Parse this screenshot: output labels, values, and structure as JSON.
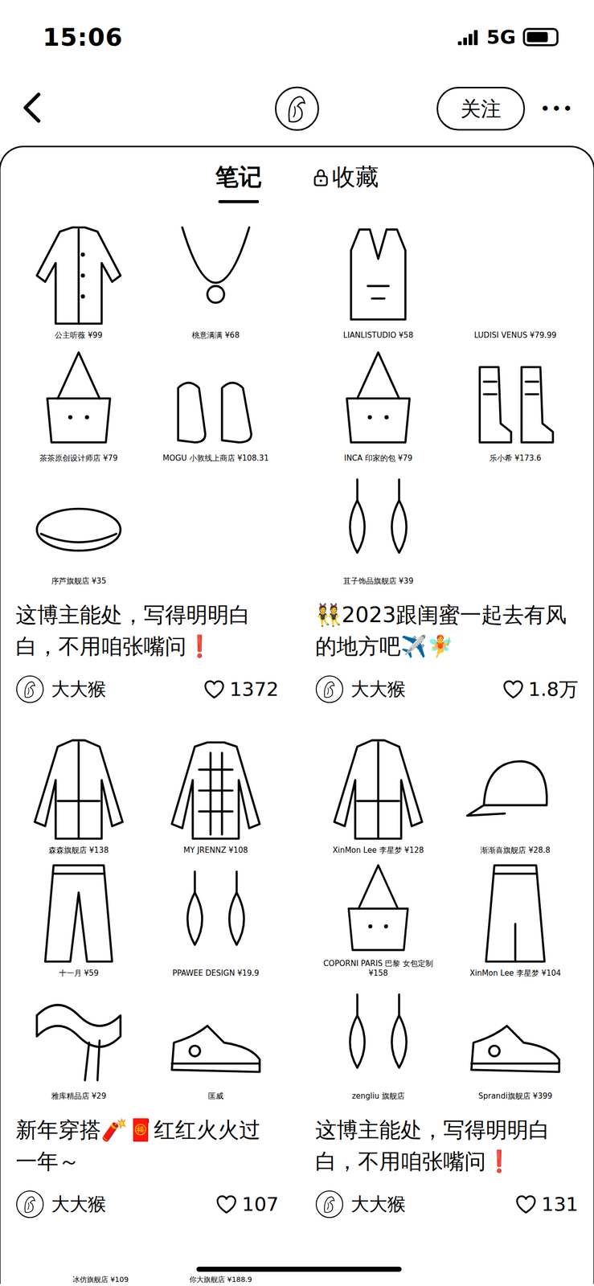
{
  "status_bar": {
    "time": "15:06",
    "network": "5G",
    "signal": 1,
    "battery": 0.75
  },
  "header": {
    "follow_button": "关注",
    "more": "•••"
  },
  "tabs": [
    {
      "label": "笔记",
      "selected": true,
      "locked": false
    },
    {
      "label": "收藏",
      "selected": false,
      "locked": true
    }
  ],
  "notes": [
    {
      "title": "这博主能处，写得明明白白，不用咱张嘴问❗",
      "author": "大大猴",
      "likes": "1372",
      "liked": false,
      "items": [
        {
          "label": "公主听薇 ¥99",
          "kind": "cardigan"
        },
        {
          "label": "桃意满满 ¥68",
          "kind": "necklace"
        },
        {
          "label": "茶茶原创设计师店 ¥79",
          "kind": "bag"
        },
        {
          "label": "MOGU 小敦线上商店 ¥108.31",
          "kind": "shoes"
        },
        {
          "label": "序芦旗舰店 ¥35",
          "kind": "beret"
        }
      ]
    },
    {
      "title": "👯2023跟闺蜜一起去有风的地方吧✈️🧚",
      "author": "大大猴",
      "likes": "1.8万",
      "liked": false,
      "items": [
        {
          "label": "LIANLISTUDIO ¥58",
          "kind": "vest"
        },
        {
          "label": "LUDISI VENUS ¥79.99",
          "kind": "label"
        },
        {
          "label": "INCA 印家的包 ¥79",
          "kind": "bag"
        },
        {
          "label": "乐小希 ¥173.6",
          "kind": "boots"
        },
        {
          "label": "苴子饰品旗舰店 ¥39",
          "kind": "earrings"
        }
      ]
    },
    {
      "title": "新年穿搭🧨🧧红红火火过一年～",
      "author": "大大猴",
      "likes": "107",
      "liked": false,
      "items": [
        {
          "label": "森森旗舰店 ¥138",
          "kind": "jacket"
        },
        {
          "label": "MY JRENNZ ¥108",
          "kind": "sweater"
        },
        {
          "label": "十一月 ¥59",
          "kind": "pants"
        },
        {
          "label": "PPAWEE DESIGN ¥19.9",
          "kind": "earrings"
        },
        {
          "label": "雅库精品店 ¥29",
          "kind": "scarf"
        },
        {
          "label": "匡威",
          "kind": "sneakers"
        }
      ]
    },
    {
      "title": "这博主能处，写得明明白白，不用咱张嘴问❗",
      "author": "大大猴",
      "likes": "131",
      "liked": false,
      "items": [
        {
          "label": "XinMon Lee 李星梦 ¥128",
          "kind": "jacket"
        },
        {
          "label": "渐渐喜旗舰店 ¥28.8",
          "kind": "cap"
        },
        {
          "label": "COPORNI PARIS 巴黎 女包定制 ¥158",
          "kind": "bag"
        },
        {
          "label": "XinMon Lee 李星梦 ¥104",
          "kind": "skirt"
        },
        {
          "label": "zengliu 旗舰店",
          "kind": "earrings"
        },
        {
          "label": "Sprandi旗舰店 ¥399",
          "kind": "sneakers"
        }
      ]
    }
  ],
  "more_row": {
    "labels": [
      "冰仿旗舰店 ¥109",
      "你大旗舰店 ¥188.9"
    ]
  }
}
